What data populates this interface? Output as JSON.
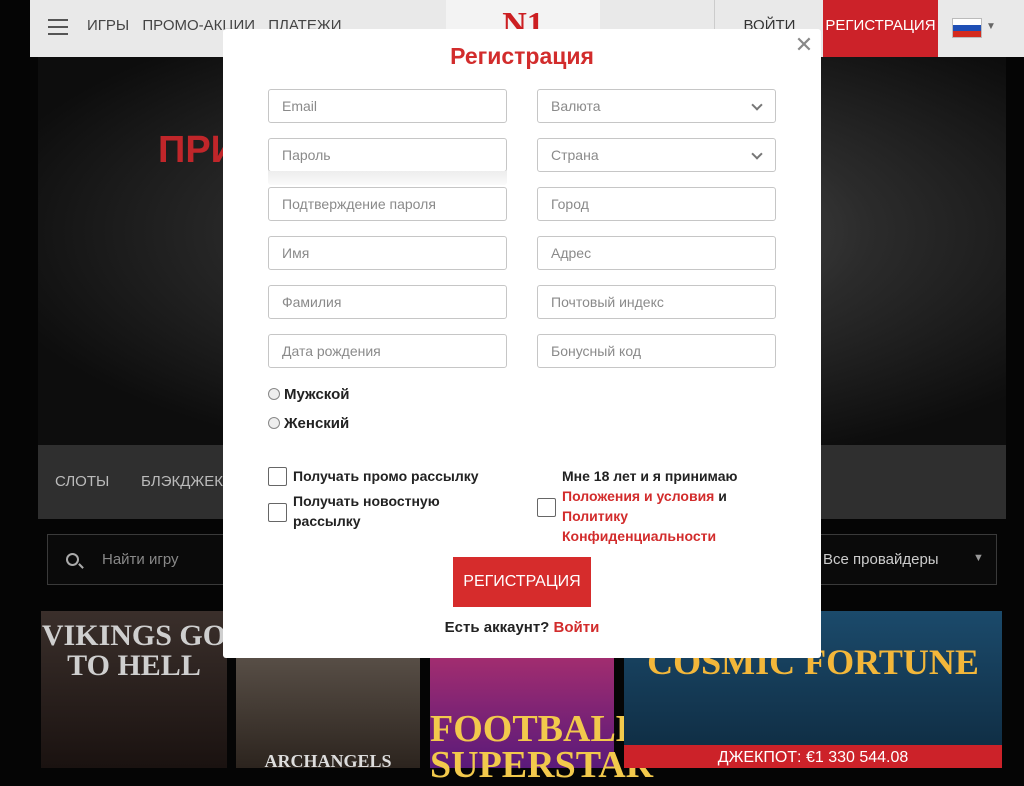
{
  "header": {
    "nav": [
      "ИГРЫ",
      "ПРОМО-АКЦИИ",
      "ПЛАТЕЖИ"
    ],
    "logo": "N1",
    "login": "ВОЙТИ",
    "register": "РЕГИСТРАЦИЯ",
    "language_flag": "russia-flag-icon"
  },
  "hero": {
    "text": "ПРИ"
  },
  "categories": [
    "СЛОТЫ",
    "БЛЭКДЖЕК"
  ],
  "search": {
    "placeholder": "Найти игру",
    "providers": "Все провайдеры"
  },
  "games": [
    {
      "title": "VIKINGS GO TO HELL"
    },
    {
      "title": "ARCHANGELS"
    },
    {
      "title": "FOOTBALL SUPERSTAR"
    },
    {
      "title": "COSMIC FORTUNE",
      "jackpot": "ДЖЕКПОТ: €1 330 544.08"
    }
  ],
  "modal": {
    "title": "Регистрация",
    "close_icon": "close-icon",
    "left_fields": [
      "Email",
      "Пароль",
      "Подтверждение пароля",
      "Имя",
      "Фамилия",
      "Дата рождения"
    ],
    "right_fields": [
      "Валюта",
      "Страна",
      "Город",
      "Адрес",
      "Почтовый индекс",
      "Бонусный код"
    ],
    "gender": [
      "Мужской",
      "Женский"
    ],
    "promo": "Получать промо рассылку",
    "news": [
      "Получать новостную",
      "рассылку"
    ],
    "terms": {
      "prefix": "Мне 18 лет и я принимаю",
      "link1": "Положения и условия",
      "and": "и",
      "link2_line1": "Политику",
      "link2_line2": "Конфиденциальности"
    },
    "submit": "РЕГИСТРАЦИЯ",
    "have_account": "Есть аккаунт?",
    "login_link": "Войти"
  },
  "colors": {
    "brand_red": "#cc2229",
    "link_red": "#d22c2c"
  }
}
